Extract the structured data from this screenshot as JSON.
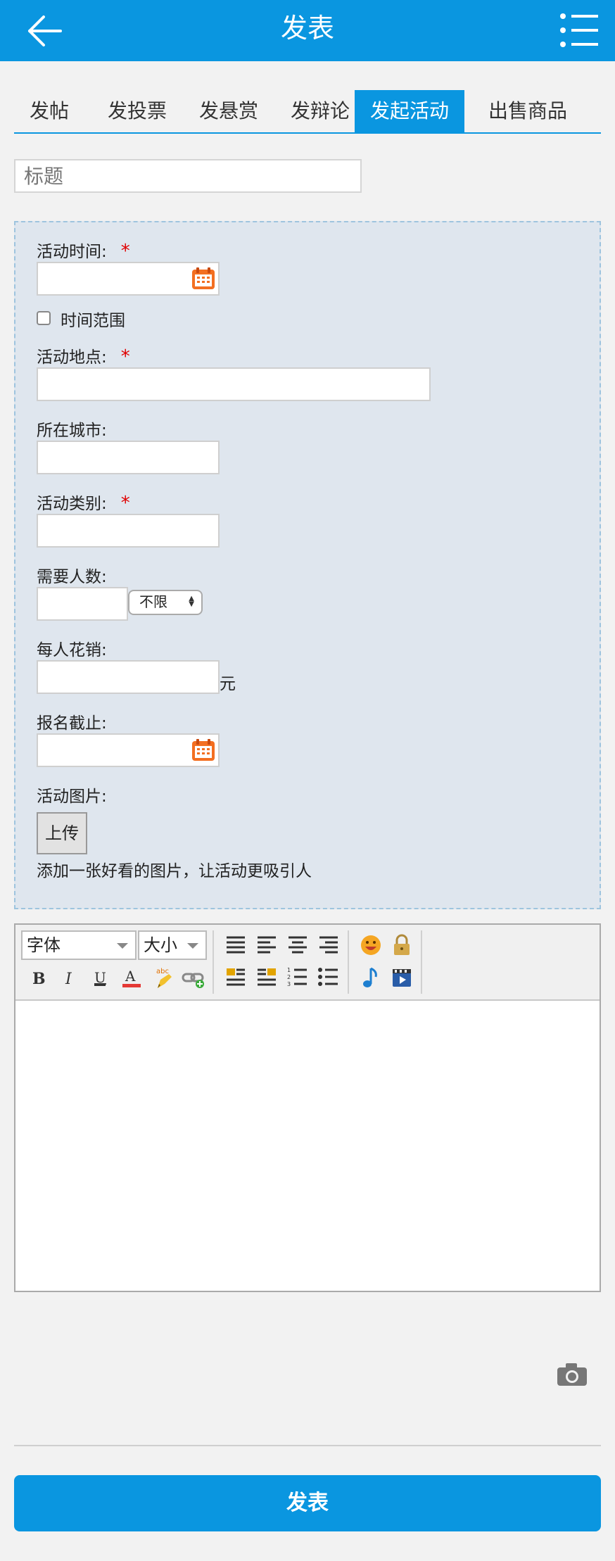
{
  "header": {
    "title": "发表",
    "back_icon": "arrow-left-icon",
    "menu_icon": "list-menu-icon"
  },
  "tabs": [
    {
      "label": "发帖"
    },
    {
      "label": "发投票"
    },
    {
      "label": "发悬赏"
    },
    {
      "label": "发辩论"
    },
    {
      "label": "发起活动",
      "active": true
    },
    {
      "label": "出售商品"
    }
  ],
  "title_field": {
    "placeholder": "标题",
    "value": ""
  },
  "activity": {
    "time_label": "活动时间:",
    "time_range_label": "时间范围",
    "place_label": "活动地点:",
    "city_label": "所在城市:",
    "category_label": "活动类别:",
    "people_label": "需要人数:",
    "people_select": "不限",
    "cost_label": "每人花销:",
    "cost_unit": "元",
    "deadline_label": "报名截止:",
    "image_label": "活动图片:",
    "upload_button": "上传",
    "image_hint": "添加一张好看的图片，让活动更吸引人",
    "required_mark": "*"
  },
  "editor": {
    "font_combo": "字体",
    "size_combo": "大小",
    "buttons": [
      "bold",
      "italic",
      "underline",
      "font-color",
      "highlight",
      "link",
      "align-justify",
      "align-left",
      "align-center",
      "align-right",
      "float-left",
      "float-right",
      "ordered-list",
      "unordered-list",
      "emoticon",
      "lock",
      "music",
      "video"
    ]
  },
  "submit_button": "发表",
  "colors": {
    "primary": "#0a96e0",
    "required": "#e00000",
    "panel_bg": "#dfe6ee"
  }
}
